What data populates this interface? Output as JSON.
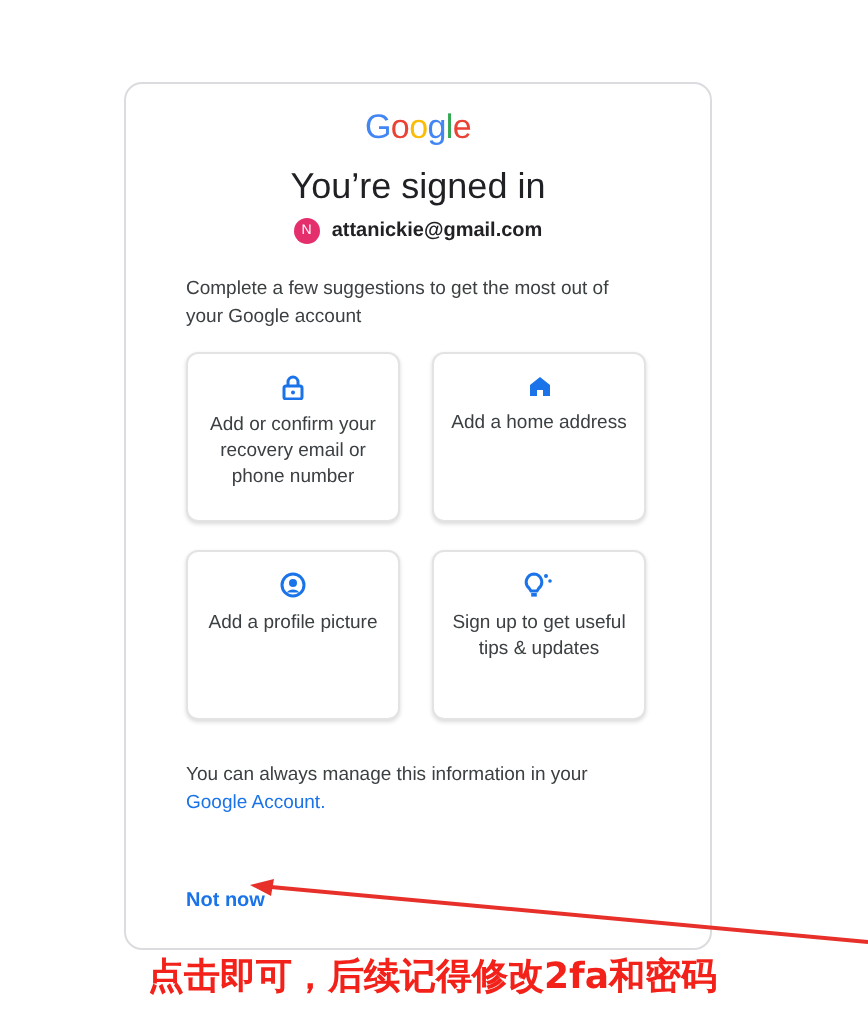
{
  "logo": "Google",
  "title": "You’re signed in",
  "account": {
    "initial": "N",
    "email": "attanickie@gmail.com"
  },
  "intro": "Complete a few suggestions to get the most out of your Google account",
  "suggestions": [
    {
      "kind": "lock",
      "label": "Add or confirm your recovery email or phone number"
    },
    {
      "kind": "home",
      "label": "Add a home address"
    },
    {
      "kind": "profile",
      "label": "Add a profile picture"
    },
    {
      "kind": "tips",
      "label": "Sign up to get useful tips & updates"
    }
  ],
  "manage_text": "You can always manage this information in your",
  "manage_link": "Google Account.",
  "not_now": "Not now",
  "annotation": "点击即可，后续记得修改2fa和密码"
}
